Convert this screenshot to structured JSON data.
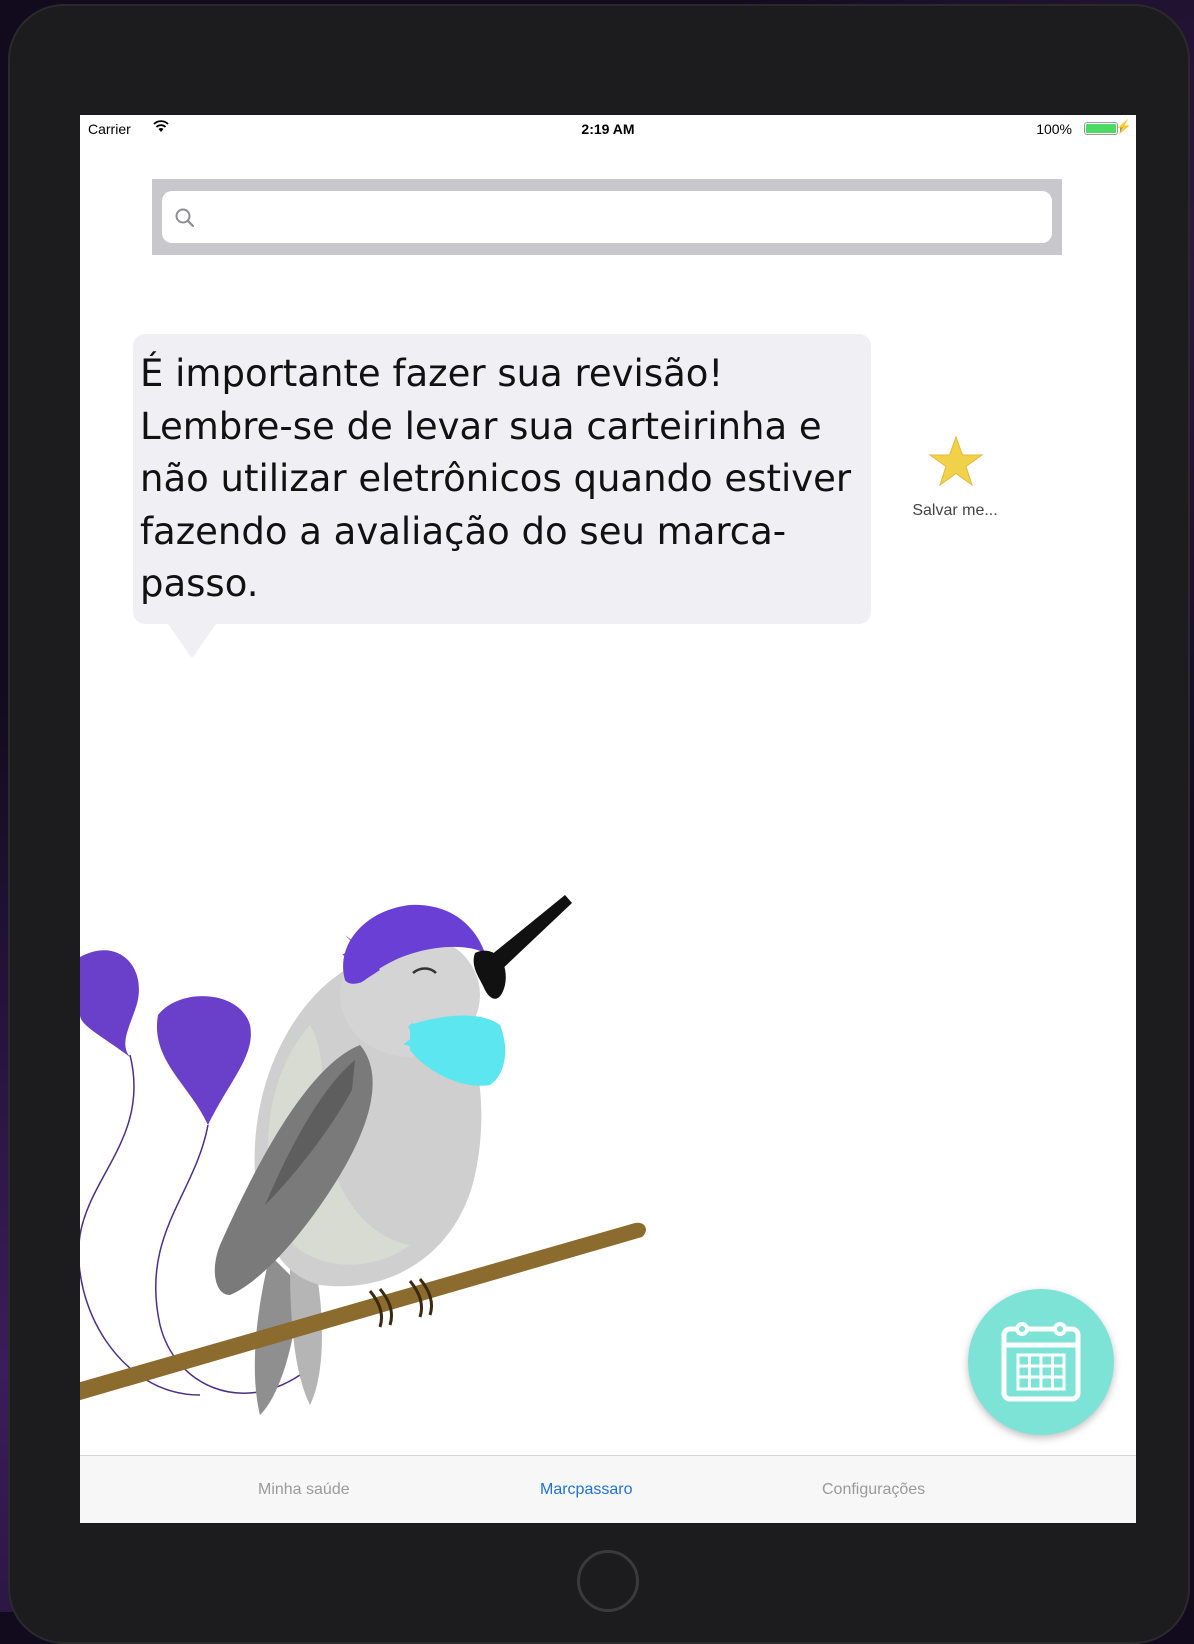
{
  "status_bar": {
    "carrier": "Carrier",
    "time": "2:19 AM",
    "battery": "100%"
  },
  "search": {
    "placeholder": "",
    "value": ""
  },
  "message": {
    "text": "É importante fazer sua revisão! Lembre-se de levar sua carteirinha e não utilizar eletrônicos quando estiver fazendo a avaliação do seu marca-passo."
  },
  "save_reminder": {
    "label": "Salvar me..."
  },
  "tabs": [
    {
      "label": "Minha saúde",
      "active": false
    },
    {
      "label": "Marcpassaro",
      "active": true
    },
    {
      "label": "Configurações",
      "active": false
    }
  ],
  "icons": {
    "search": "search-icon",
    "star": "star-icon",
    "calendar": "calendar-icon",
    "wifi": "wifi-icon",
    "battery": "battery-icon"
  },
  "colors": {
    "tab_active": "#1e72d6",
    "tab_inactive": "#9a9a9a",
    "fab": "#7de3d6",
    "star": "#f2d14a",
    "bird_crest": "#6a3fd6",
    "bird_throat": "#5ce6ef"
  }
}
